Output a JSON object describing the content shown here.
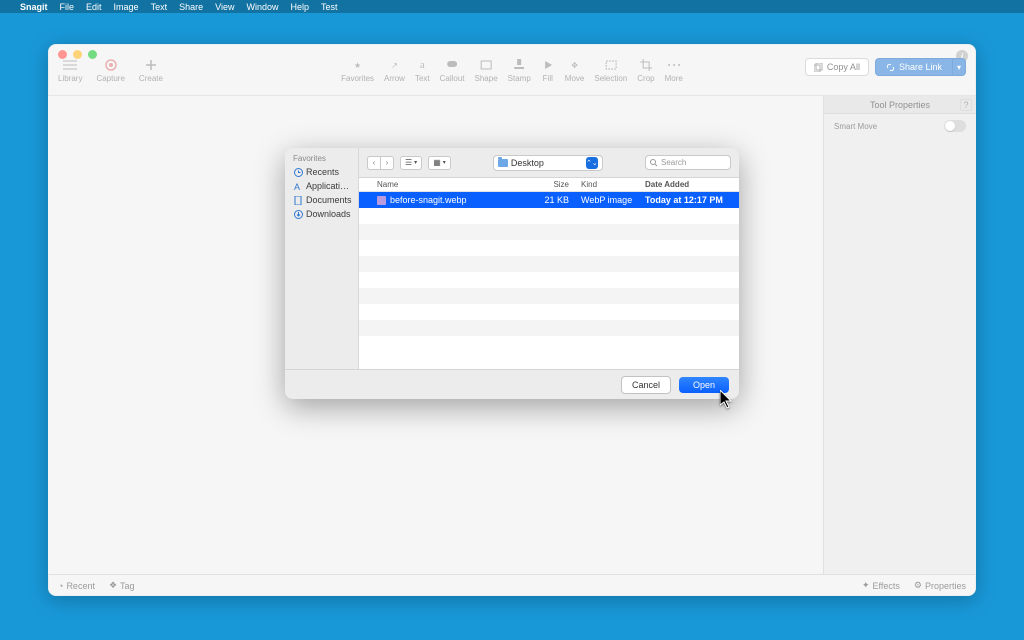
{
  "menubar": {
    "app": "Snagit",
    "items": [
      "File",
      "Edit",
      "Image",
      "Text",
      "Share",
      "View",
      "Window",
      "Help",
      "Test"
    ]
  },
  "toolbar": {
    "left": [
      {
        "label": "Library"
      },
      {
        "label": "Capture"
      },
      {
        "label": "Create"
      }
    ],
    "center": [
      {
        "label": "Favorites"
      },
      {
        "label": "Arrow"
      },
      {
        "label": "Text"
      },
      {
        "label": "Callout"
      },
      {
        "label": "Shape"
      },
      {
        "label": "Stamp"
      },
      {
        "label": "Fill"
      },
      {
        "label": "Move"
      },
      {
        "label": "Selection"
      },
      {
        "label": "Crop"
      }
    ],
    "more": "More",
    "copy_all": "Copy All",
    "share": "Share Link",
    "panel_title": "Tool Properties",
    "smart_move": "Smart Move"
  },
  "statusbar": {
    "recent": "Recent",
    "tag": "Tag",
    "effects": "Effects",
    "properties": "Properties"
  },
  "dialog": {
    "sidebar_header": "Favorites",
    "sidebar": [
      {
        "label": "Recents"
      },
      {
        "label": "Applicati…"
      },
      {
        "label": "Documents"
      },
      {
        "label": "Downloads"
      }
    ],
    "location": "Desktop",
    "search_placeholder": "Search",
    "columns": {
      "name": "Name",
      "size": "Size",
      "kind": "Kind",
      "date": "Date Added"
    },
    "rows": [
      {
        "name": "before-snagit.webp",
        "size": "21 KB",
        "kind": "WebP image",
        "date": "Today at 12:17 PM",
        "selected": true
      }
    ],
    "cancel": "Cancel",
    "open": "Open"
  }
}
